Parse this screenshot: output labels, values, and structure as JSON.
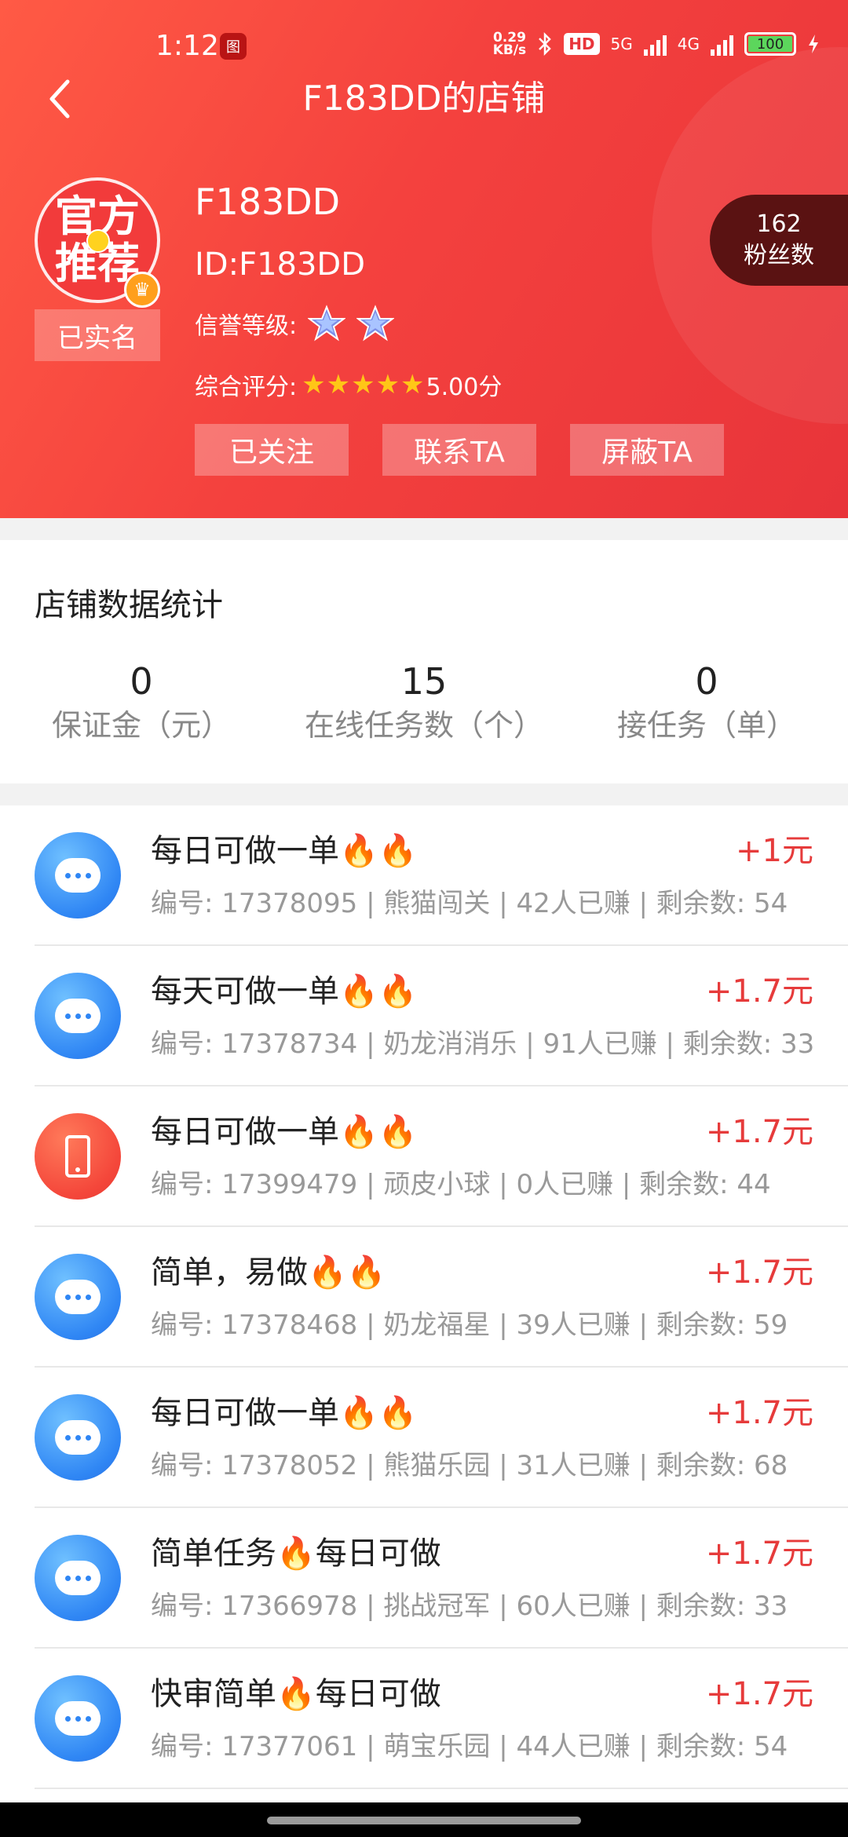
{
  "status_bar": {
    "time": "1:12",
    "msg_icon": "图",
    "speed_value": "0.29",
    "speed_unit": "KB/s",
    "hd_label": "HD",
    "net_5g": "5G",
    "net_4g": "4G",
    "battery": "100"
  },
  "nav": {
    "title": "F183DD的店铺"
  },
  "profile": {
    "avatar_line1": "官方",
    "avatar_line2": "推荐",
    "verified": "已实名",
    "name": "F183DD",
    "id": "ID:F183DD",
    "credit_label": "信誉等级:",
    "rating_label": "综合评分:",
    "rating_value": "5.00分",
    "rating_stars": 5,
    "fans_count": "162",
    "fans_label": "粉丝数",
    "buttons": {
      "follow": "已关注",
      "contact": "联系TA",
      "block": "屏蔽TA"
    }
  },
  "stats": {
    "title": "店铺数据统计",
    "items": [
      {
        "value": "0",
        "label": "保证金（元）"
      },
      {
        "value": "15",
        "label": "在线任务数（个）"
      },
      {
        "value": "0",
        "label": "接任务（单）"
      }
    ]
  },
  "tasks": [
    {
      "icon": "chat-icon",
      "title": "每日可做一单🔥🔥",
      "meta": "编号: 17378095 | 熊猫闯关 | 42人已赚 | 剩余数: 54",
      "reward": "+1元"
    },
    {
      "icon": "chat-icon",
      "title": "每天可做一单🔥🔥",
      "meta": "编号: 17378734 | 奶龙消消乐 | 91人已赚 | 剩余数: 33",
      "reward": "+1.7元"
    },
    {
      "icon": "phone-icon",
      "title": "每日可做一单🔥🔥",
      "meta": "编号: 17399479 | 顽皮小球 | 0人已赚 | 剩余数: 44",
      "reward": "+1.7元"
    },
    {
      "icon": "chat-icon",
      "title": "简单，易做🔥🔥",
      "meta": "编号: 17378468 | 奶龙福星 | 39人已赚 | 剩余数: 59",
      "reward": "+1.7元"
    },
    {
      "icon": "chat-icon",
      "title": "每日可做一单🔥🔥",
      "meta": "编号: 17378052 | 熊猫乐园 | 31人已赚 | 剩余数: 68",
      "reward": "+1.7元"
    },
    {
      "icon": "chat-icon",
      "title": "简单任务🔥每日可做",
      "meta": "编号: 17366978 | 挑战冠军 | 60人已赚 | 剩余数: 33",
      "reward": "+1.7元"
    },
    {
      "icon": "chat-icon",
      "title": "快审简单🔥每日可做",
      "meta": "编号: 17377061 | 萌宝乐园 | 44人已赚 | 剩余数: 54",
      "reward": "+1.7元"
    }
  ],
  "colors": {
    "header_red": "#f4413e",
    "reward_red": "#e63b3b",
    "icon_blue": "#2f86f4",
    "icon_red": "#f4463a",
    "fans_bg": "#5a1212"
  }
}
